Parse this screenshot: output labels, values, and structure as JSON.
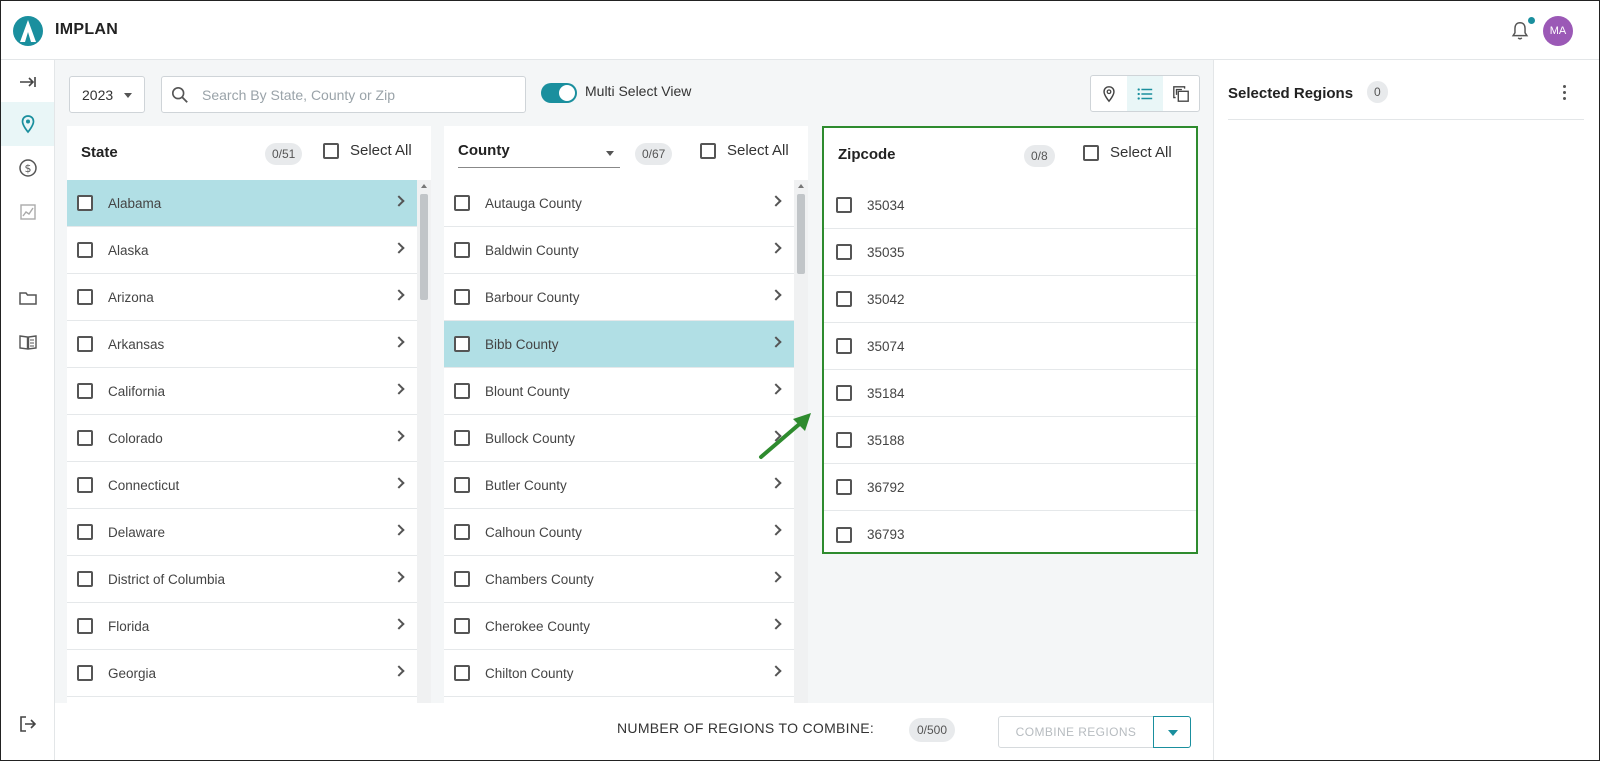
{
  "app": {
    "brand": "IMPLAN",
    "user_initials": "MA"
  },
  "toolbar": {
    "year": "2023",
    "search_placeholder": "Search By State, County or Zip",
    "toggle_label": "Multi Select View"
  },
  "state_col": {
    "title": "State",
    "count": "0/51",
    "select_all": "Select All",
    "items": [
      "Alabama",
      "Alaska",
      "Arizona",
      "Arkansas",
      "California",
      "Colorado",
      "Connecticut",
      "Delaware",
      "District of Columbia",
      "Florida",
      "Georgia"
    ]
  },
  "county_col": {
    "title": "County",
    "count": "0/67",
    "select_all": "Select All",
    "items": [
      "Autauga County",
      "Baldwin County",
      "Barbour County",
      "Bibb County",
      "Blount County",
      "Bullock County",
      "Butler County",
      "Calhoun County",
      "Chambers County",
      "Cherokee County",
      "Chilton County"
    ]
  },
  "zip_col": {
    "title": "Zipcode",
    "count": "0/8",
    "select_all": "Select All",
    "items": [
      "35034",
      "35035",
      "35042",
      "35074",
      "35184",
      "35188",
      "36792",
      "36793"
    ]
  },
  "bottom": {
    "combine_label": "NUMBER OF REGIONS TO COMBINE:",
    "combine_count": "0/500",
    "combine_button": "COMBINE REGIONS"
  },
  "right_panel": {
    "title": "Selected Regions",
    "count": "0"
  },
  "colors": {
    "accent": "#1a8f9e",
    "selected_row": "#b1dfe5",
    "highlight_border": "#2e8b2e",
    "avatar": "#9b59b6"
  }
}
